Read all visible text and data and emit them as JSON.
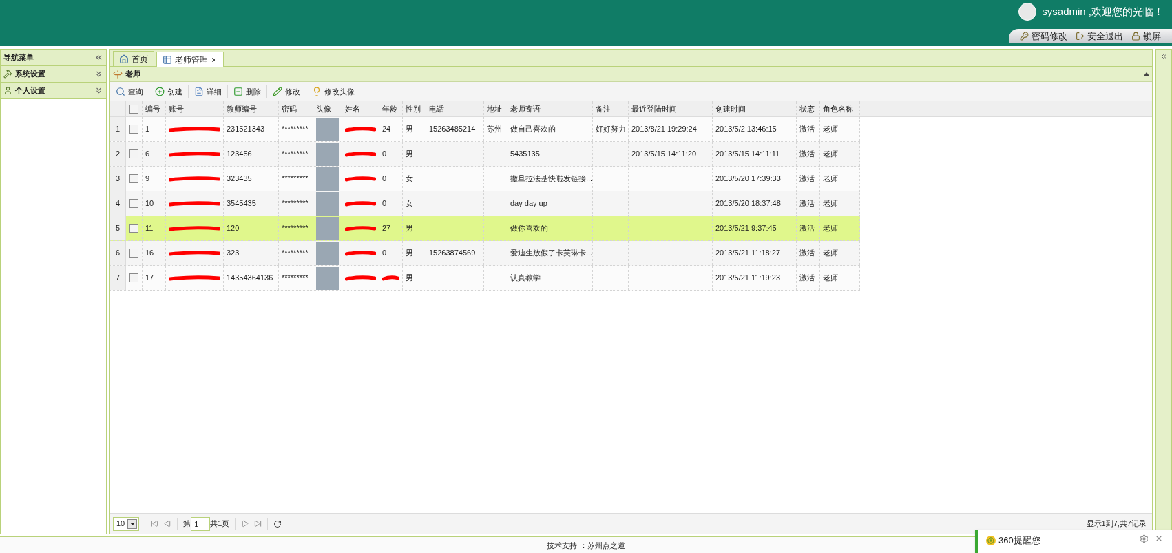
{
  "header": {
    "welcome": "sysadmin ,欢迎您的光临！",
    "links": [
      {
        "kind": "password",
        "label": "密码修改"
      },
      {
        "kind": "logout",
        "label": "安全退出"
      },
      {
        "kind": "lock",
        "label": "锁屏"
      }
    ]
  },
  "sidebar": {
    "title": "导航菜单",
    "items": [
      {
        "kind": "tools",
        "label": "系统设置",
        "expanded": false
      },
      {
        "kind": "user",
        "label": "个人设置",
        "expanded": false
      }
    ]
  },
  "tabs": [
    {
      "kind": "home",
      "label": "首页",
      "selected": false
    },
    {
      "kind": "grid",
      "label": "老师管理",
      "selected": true
    }
  ],
  "panel": {
    "title": "老师"
  },
  "toolbar": [
    {
      "kind": "search",
      "label": "查询"
    },
    {
      "kind": "create",
      "label": "创建"
    },
    {
      "kind": "detail",
      "label": "详细"
    },
    {
      "kind": "delete",
      "label": "删除"
    },
    {
      "kind": "edit",
      "label": "修改"
    },
    {
      "kind": "avatar",
      "label": "修改头像"
    }
  ],
  "table": {
    "all_checked": false,
    "columns": [
      "编号",
      "账号",
      "教师编号",
      "密码",
      "头像",
      "姓名",
      "年龄",
      "性别",
      "电话",
      "地址",
      "老师寄语",
      "备注",
      "最近登陆时间",
      "创建时间",
      "状态",
      "角色名称"
    ],
    "rows": [
      {
        "row_number": "1",
        "checked": false,
        "selected": false,
        "cells": [
          {
            "kind": "text",
            "text": "1"
          },
          {
            "kind": "redacted"
          },
          {
            "kind": "text",
            "text": "231521343"
          },
          {
            "kind": "text",
            "text": "*********"
          },
          {
            "kind": "avatar"
          },
          {
            "kind": "redacted"
          },
          {
            "kind": "text",
            "text": "24"
          },
          {
            "kind": "text",
            "text": "男"
          },
          {
            "kind": "text",
            "text": "15263485214"
          },
          {
            "kind": "text",
            "text": "苏州"
          },
          {
            "kind": "text",
            "text": "做自己喜欢的"
          },
          {
            "kind": "text",
            "text": "好好努力"
          },
          {
            "kind": "text",
            "text": "2013/8/21 19:29:24"
          },
          {
            "kind": "text",
            "text": "2013/5/2 13:46:15"
          },
          {
            "kind": "text",
            "text": "激活"
          },
          {
            "kind": "text",
            "text": "老师"
          }
        ]
      },
      {
        "row_number": "2",
        "checked": false,
        "selected": false,
        "cells": [
          {
            "kind": "text",
            "text": "6"
          },
          {
            "kind": "redacted"
          },
          {
            "kind": "text",
            "text": "123456"
          },
          {
            "kind": "text",
            "text": "*********"
          },
          {
            "kind": "avatar"
          },
          {
            "kind": "redacted"
          },
          {
            "kind": "text",
            "text": "0"
          },
          {
            "kind": "text",
            "text": "男"
          },
          {
            "kind": "empty"
          },
          {
            "kind": "empty"
          },
          {
            "kind": "text",
            "text": "5435135"
          },
          {
            "kind": "empty"
          },
          {
            "kind": "text",
            "text": "2013/5/15 14:11:20"
          },
          {
            "kind": "text",
            "text": "2013/5/15 14:11:11"
          },
          {
            "kind": "text",
            "text": "激活"
          },
          {
            "kind": "text",
            "text": "老师"
          }
        ]
      },
      {
        "row_number": "3",
        "checked": false,
        "selected": false,
        "cells": [
          {
            "kind": "text",
            "text": "9"
          },
          {
            "kind": "redacted"
          },
          {
            "kind": "text",
            "text": "323435"
          },
          {
            "kind": "text",
            "text": "*********"
          },
          {
            "kind": "avatar"
          },
          {
            "kind": "redacted"
          },
          {
            "kind": "text",
            "text": "0"
          },
          {
            "kind": "text",
            "text": "女"
          },
          {
            "kind": "empty"
          },
          {
            "kind": "empty"
          },
          {
            "kind": "text",
            "text": "撒旦拉法基快啦发链接..."
          },
          {
            "kind": "empty"
          },
          {
            "kind": "empty"
          },
          {
            "kind": "text",
            "text": "2013/5/20 17:39:33"
          },
          {
            "kind": "text",
            "text": "激活"
          },
          {
            "kind": "text",
            "text": "老师"
          }
        ]
      },
      {
        "row_number": "4",
        "checked": false,
        "selected": false,
        "cells": [
          {
            "kind": "text",
            "text": "10"
          },
          {
            "kind": "redacted"
          },
          {
            "kind": "text",
            "text": "3545435"
          },
          {
            "kind": "text",
            "text": "*********"
          },
          {
            "kind": "avatar"
          },
          {
            "kind": "redacted"
          },
          {
            "kind": "text",
            "text": "0"
          },
          {
            "kind": "text",
            "text": "女"
          },
          {
            "kind": "empty"
          },
          {
            "kind": "empty"
          },
          {
            "kind": "text",
            "text": "day day up"
          },
          {
            "kind": "empty"
          },
          {
            "kind": "empty"
          },
          {
            "kind": "text",
            "text": "2013/5/20 18:37:48"
          },
          {
            "kind": "text",
            "text": "激活"
          },
          {
            "kind": "text",
            "text": "老师"
          }
        ]
      },
      {
        "row_number": "5",
        "checked": false,
        "selected": true,
        "cells": [
          {
            "kind": "text",
            "text": "11"
          },
          {
            "kind": "redacted"
          },
          {
            "kind": "text",
            "text": "120"
          },
          {
            "kind": "text",
            "text": "*********"
          },
          {
            "kind": "avatar"
          },
          {
            "kind": "redacted"
          },
          {
            "kind": "text",
            "text": "27"
          },
          {
            "kind": "text",
            "text": "男"
          },
          {
            "kind": "empty"
          },
          {
            "kind": "empty"
          },
          {
            "kind": "text",
            "text": "做你喜欢的"
          },
          {
            "kind": "empty"
          },
          {
            "kind": "empty"
          },
          {
            "kind": "text",
            "text": "2013/5/21 9:37:45"
          },
          {
            "kind": "text",
            "text": "激活"
          },
          {
            "kind": "text",
            "text": "老师"
          }
        ]
      },
      {
        "row_number": "6",
        "checked": false,
        "selected": false,
        "cells": [
          {
            "kind": "text",
            "text": "16"
          },
          {
            "kind": "redacted"
          },
          {
            "kind": "text",
            "text": "323"
          },
          {
            "kind": "text",
            "text": "*********"
          },
          {
            "kind": "avatar"
          },
          {
            "kind": "redacted"
          },
          {
            "kind": "text",
            "text": "0"
          },
          {
            "kind": "text",
            "text": "男"
          },
          {
            "kind": "text",
            "text": "15263874569"
          },
          {
            "kind": "empty"
          },
          {
            "kind": "text",
            "text": "爱迪生放假了卡芙琳卡..."
          },
          {
            "kind": "empty"
          },
          {
            "kind": "empty"
          },
          {
            "kind": "text",
            "text": "2013/5/21 11:18:27"
          },
          {
            "kind": "text",
            "text": "激活"
          },
          {
            "kind": "text",
            "text": "老师"
          }
        ]
      },
      {
        "row_number": "7",
        "checked": false,
        "selected": false,
        "cells": [
          {
            "kind": "text",
            "text": "17"
          },
          {
            "kind": "redacted"
          },
          {
            "kind": "text",
            "text": "14354364136"
          },
          {
            "kind": "text",
            "text": "*********"
          },
          {
            "kind": "avatar"
          },
          {
            "kind": "redacted"
          },
          {
            "kind": "redacted"
          },
          {
            "kind": "text",
            "text": "男"
          },
          {
            "kind": "empty"
          },
          {
            "kind": "empty"
          },
          {
            "kind": "text",
            "text": "认真教学"
          },
          {
            "kind": "empty"
          },
          {
            "kind": "empty"
          },
          {
            "kind": "text",
            "text": "2013/5/21 11:19:23"
          },
          {
            "kind": "text",
            "text": "激活"
          },
          {
            "kind": "text",
            "text": "老师"
          }
        ]
      }
    ]
  },
  "pager": {
    "page_size": "10",
    "page_prefix": "第",
    "page": "1",
    "page_suffix": "共1页",
    "summary": "显示1到7,共7记录"
  },
  "footer": {
    "text": "技术支持 ：苏州点之道"
  },
  "notification": {
    "title": "360提醒您"
  }
}
